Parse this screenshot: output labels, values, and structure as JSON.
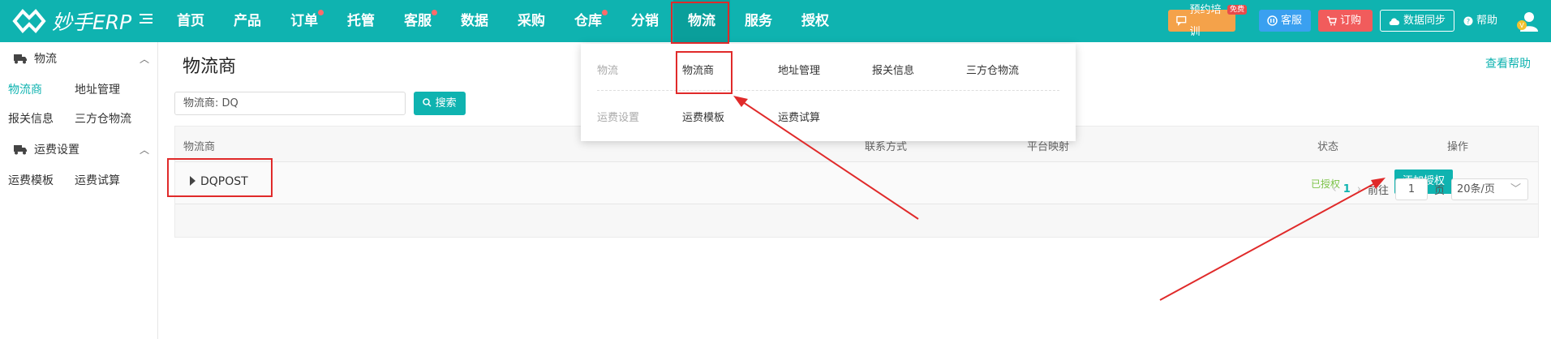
{
  "brand": {
    "name": "妙手ERP"
  },
  "top_nav": [
    {
      "label": "首页",
      "dot": false
    },
    {
      "label": "产品",
      "dot": false
    },
    {
      "label": "订单",
      "dot": true
    },
    {
      "label": "托管",
      "dot": false
    },
    {
      "label": "客服",
      "dot": true
    },
    {
      "label": "数据",
      "dot": false
    },
    {
      "label": "采购",
      "dot": false
    },
    {
      "label": "仓库",
      "dot": true
    },
    {
      "label": "分销",
      "dot": false
    },
    {
      "label": "物流",
      "dot": false,
      "active": true
    },
    {
      "label": "服务",
      "dot": false
    },
    {
      "label": "授权",
      "dot": false
    }
  ],
  "toolbar": {
    "training": "预约培训",
    "free_badge": "免费",
    "service": "客服",
    "order": "订购",
    "sync": "数据同步",
    "help": "帮助"
  },
  "sidebar": {
    "groups": [
      {
        "title": "物流",
        "links": [
          "物流商",
          "地址管理",
          "报关信息",
          "三方仓物流"
        ]
      },
      {
        "title": "运费设置",
        "links": [
          "运费模板",
          "运费试算"
        ]
      }
    ]
  },
  "page": {
    "title": "物流商",
    "help_link": "查看帮助",
    "search_value": "物流商:  DQ",
    "search_button": "搜索"
  },
  "table": {
    "columns": [
      "物流商",
      "联系方式",
      "平台映射",
      "状态",
      "操作"
    ],
    "rows": [
      {
        "name": "DQPOST",
        "status": "已授权",
        "action": "添加授权"
      }
    ]
  },
  "pager": {
    "current_page": "1",
    "goto_label": "前往",
    "goto_value": "1",
    "page_unit": "页",
    "page_size": "20条/页"
  },
  "dropdown": {
    "rows": [
      {
        "head": "物流",
        "links": [
          "物流商",
          "地址管理",
          "报关信息",
          "三方仓物流"
        ]
      },
      {
        "head": "运费设置",
        "links": [
          "运费模板",
          "运费试算"
        ]
      }
    ]
  },
  "colors": {
    "brand_teal": "#0fb3b0",
    "annotation_red": "#e02a2a",
    "status_green": "#7cc348"
  }
}
